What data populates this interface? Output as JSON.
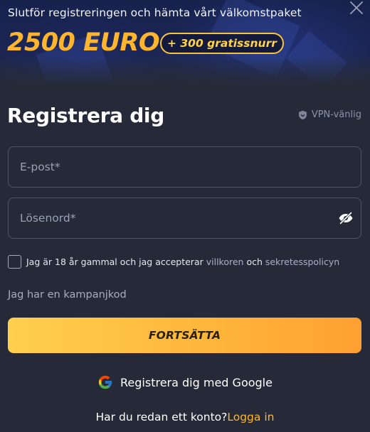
{
  "hero": {
    "subtitle": "Slutför registreringen och hämta vårt välkomstpaket",
    "bonus_amount": "2500 EURO",
    "free_spins_badge": "+ 300 gratissnurr"
  },
  "form": {
    "title": "Registrera dig",
    "vpn_label": "VPN-vänlig",
    "email_placeholder": "E-post*",
    "email_value": "",
    "password_placeholder": "Lösenord*",
    "password_value": "",
    "terms_prefix": "Jag är 18 år gammal och jag accepterar ",
    "terms_link": "villkoren",
    "terms_and": " och ",
    "privacy_link": "sekretesspolicyn",
    "terms_checked": false,
    "promo_code_link": "Jag har en kampanjkod",
    "continue_button": "FORTSÄTTA",
    "google_button": "Registrera dig med Google",
    "login_prompt": "Har du redan ett konto?",
    "login_link": "Logga in"
  },
  "icons": {
    "close": "close-icon",
    "vpn": "shield-icon",
    "password_toggle": "eye-slash-icon",
    "google": "google-icon"
  },
  "colors": {
    "accent": "#ffb62e",
    "background": "#262a38",
    "button_gradient_start": "#ffd04d",
    "button_gradient_end": "#ffa033"
  }
}
